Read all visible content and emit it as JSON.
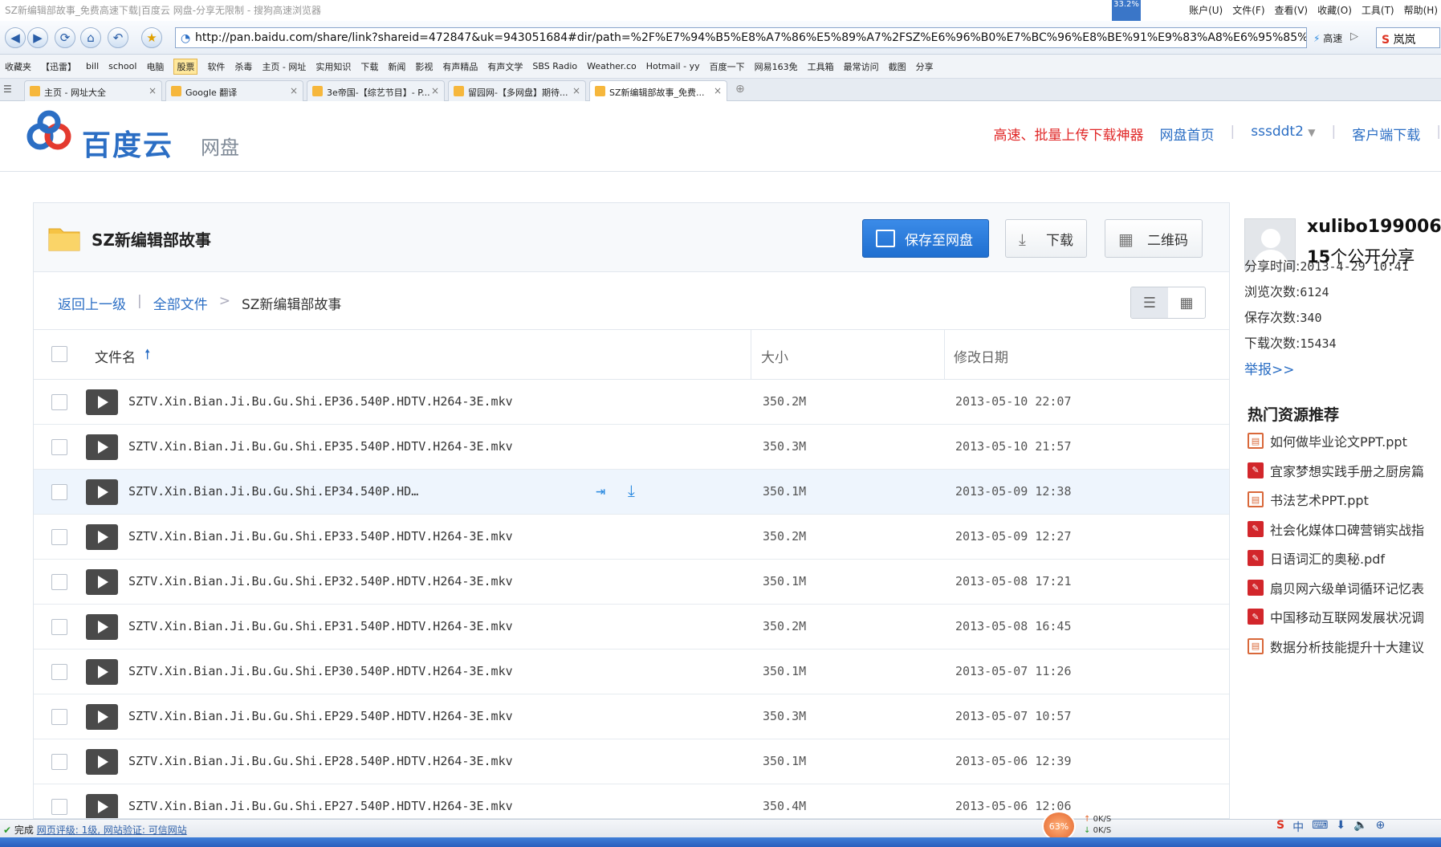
{
  "browser": {
    "window_title": "SZ新编辑部故事_免费高速下载|百度云 网盘-分享无限制 - 搜狗高速浏览器",
    "menus": [
      "账户(U)",
      "文件(F)",
      "查看(V)",
      "收藏(O)",
      "工具(T)",
      "帮助(H)"
    ],
    "net_badge": "33.2%",
    "address": "http://pan.baidu.com/share/link?shareid=472847&uk=943051684#dir/path=%2F%E7%94%B5%E8%A7%86%E5%89%A7%2FSZ%E6%96%B0%E7%BC%96%E8%BE%91%E9%83%A8%E6%95%85%E",
    "speed_mode_label": "高速",
    "search_value": "岚岚",
    "bookmarks": [
      "收藏夹",
      "【迅雷】",
      "bill",
      "school",
      "电脑",
      "股票",
      "软件",
      "杀毒",
      "主页 - 网址",
      "实用知识",
      "下载",
      "新闻",
      "影视",
      "有声精品",
      "有声文学",
      "SBS Radio",
      "Weather.co",
      "Hotmail - yy",
      "百度一下",
      "网易163免",
      "工具箱",
      "最常访问",
      "截图",
      "分享"
    ],
    "active_bookmark_index": 5,
    "tabs": [
      {
        "label": "主页 - 网址大全",
        "active": false
      },
      {
        "label": "Google 翻译",
        "active": false
      },
      {
        "label": "3e帝国-【综艺节目】- P...",
        "active": false
      },
      {
        "label": "留园网-【多网盘】期待...",
        "active": false
      },
      {
        "label": "SZ新编辑部故事_免费...",
        "active": true
      }
    ]
  },
  "header": {
    "brand": "百度云",
    "sub": "网盘",
    "promo_link": "高速、批量上传下载神器",
    "nav_home": "网盘首页",
    "user": "sssddt2",
    "client_download": "客户端下载"
  },
  "folder": {
    "title": "SZ新编辑部故事",
    "save_label": "保存至网盘",
    "download_label": "下载",
    "qr_label": "二维码"
  },
  "breadcrumb": {
    "up": "返回上一级",
    "all": "全部文件",
    "sep": ">",
    "current": "SZ新编辑部故事"
  },
  "columns": {
    "name": "文件名",
    "size": "大小",
    "date": "修改日期"
  },
  "files": [
    {
      "name": "SZTV.Xin.Bian.Ji.Bu.Gu.Shi.EP36.540P.HDTV.H264-3E.mkv",
      "size": "350.2M",
      "date": "2013-05-10 22:07"
    },
    {
      "name": "SZTV.Xin.Bian.Ji.Bu.Gu.Shi.EP35.540P.HDTV.H264-3E.mkv",
      "size": "350.3M",
      "date": "2013-05-10 21:57"
    },
    {
      "name": "SZTV.Xin.Bian.Ji.Bu.Gu.Shi.EP34.540P.HD…",
      "size": "350.1M",
      "date": "2013-05-09 12:38"
    },
    {
      "name": "SZTV.Xin.Bian.Ji.Bu.Gu.Shi.EP33.540P.HDTV.H264-3E.mkv",
      "size": "350.2M",
      "date": "2013-05-09 12:27"
    },
    {
      "name": "SZTV.Xin.Bian.Ji.Bu.Gu.Shi.EP32.540P.HDTV.H264-3E.mkv",
      "size": "350.1M",
      "date": "2013-05-08 17:21"
    },
    {
      "name": "SZTV.Xin.Bian.Ji.Bu.Gu.Shi.EP31.540P.HDTV.H264-3E.mkv",
      "size": "350.2M",
      "date": "2013-05-08 16:45"
    },
    {
      "name": "SZTV.Xin.Bian.Ji.Bu.Gu.Shi.EP30.540P.HDTV.H264-3E.mkv",
      "size": "350.1M",
      "date": "2013-05-07 11:26"
    },
    {
      "name": "SZTV.Xin.Bian.Ji.Bu.Gu.Shi.EP29.540P.HDTV.H264-3E.mkv",
      "size": "350.3M",
      "date": "2013-05-07 10:57"
    },
    {
      "name": "SZTV.Xin.Bian.Ji.Bu.Gu.Shi.EP28.540P.HDTV.H264-3E.mkv",
      "size": "350.1M",
      "date": "2013-05-06 12:39"
    },
    {
      "name": "SZTV.Xin.Bian.Ji.Bu.Gu.Shi.EP27.540P.HDTV.H264-3E.mkv",
      "size": "350.4M",
      "date": "2013-05-06 12:06"
    }
  ],
  "hover_row_index": 2,
  "sharer": {
    "username": "xulibo199006",
    "share_count": "15",
    "share_count_suffix": "个公开分享",
    "share_time_label": "分享时间:",
    "share_time": "2013-4-29 10:41",
    "views_label": "浏览次数:",
    "views": "6124",
    "saves_label": "保存次数:",
    "saves": "340",
    "downloads_label": "下载次数:",
    "downloads": "15434",
    "report": "举报>>"
  },
  "hot": {
    "title": "热门资源推荐",
    "items": [
      {
        "label": "如何做毕业论文PPT.ppt",
        "type": "ppt"
      },
      {
        "label": "宜家梦想实践手册之厨房篇",
        "type": "pdf"
      },
      {
        "label": "书法艺术PPT.ppt",
        "type": "ppt"
      },
      {
        "label": "社会化媒体口碑营销实战指",
        "type": "pdf"
      },
      {
        "label": "日语词汇的奥秘.pdf",
        "type": "pdf"
      },
      {
        "label": "扇贝网六级单词循环记忆表",
        "type": "pdf"
      },
      {
        "label": "中国移动互联网发展状况调",
        "type": "pdf"
      },
      {
        "label": "数据分析技能提升十大建议",
        "type": "ppt"
      }
    ]
  },
  "status": {
    "done": "完成",
    "rating": "网页评级: 1级, 网站验证: 可信网站",
    "net_percent": "63%",
    "up_speed": "0K/S",
    "down_speed": "0K/S",
    "ime": "中"
  }
}
